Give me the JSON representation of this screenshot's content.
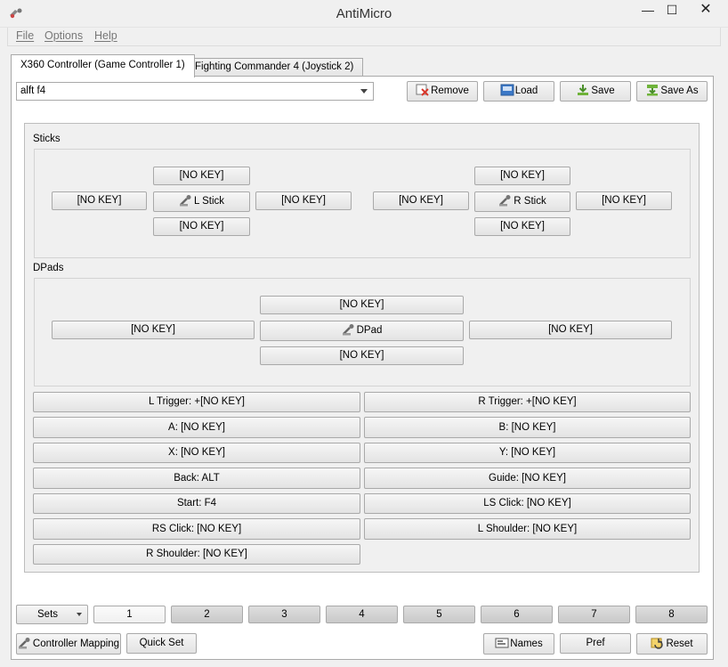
{
  "window": {
    "title": "AntiMicro",
    "icon": "gamepad-icon",
    "controls": {
      "minimize": "—",
      "maximize": "☐",
      "close": "✕"
    }
  },
  "menu": {
    "file": "File",
    "options": "Options",
    "help": "Help"
  },
  "tabs": [
    {
      "label": "X360 Controller (Game Controller 1)",
      "active": true
    },
    {
      "label": "Fighting Commander 4 (Joystick 2)",
      "active": false
    }
  ],
  "profile": {
    "selected": "alft f4",
    "remove_label": "Remove",
    "load_label": "Load",
    "save_label": "Save",
    "save_as_label": "Save As"
  },
  "sticks": {
    "label": "Sticks",
    "left": {
      "up": "[NO KEY]",
      "left": "[NO KEY]",
      "center": "L Stick",
      "right": "[NO KEY]",
      "down": "[NO KEY]"
    },
    "right": {
      "up": "[NO KEY]",
      "left": "[NO KEY]",
      "center": "R Stick",
      "right": "[NO KEY]",
      "down": "[NO KEY]"
    }
  },
  "dpads": {
    "label": "DPads",
    "up": "[NO KEY]",
    "left": "[NO KEY]",
    "center": "DPad",
    "right": "[NO KEY]",
    "down": "[NO KEY]"
  },
  "buttons": {
    "l_trigger": "L Trigger: +[NO KEY]",
    "r_trigger": "R Trigger: +[NO KEY]",
    "a": "A: [NO KEY]",
    "b": "B: [NO KEY]",
    "x": "X: [NO KEY]",
    "y": "Y: [NO KEY]",
    "back": "Back: ALT",
    "guide": "Guide: [NO KEY]",
    "start": "Start: F4",
    "ls_click": "LS Click: [NO KEY]",
    "rs_click": "RS Click: [NO KEY]",
    "l_shoulder": "L Shoulder: [NO KEY]",
    "r_shoulder": "R Shoulder: [NO KEY]"
  },
  "sets": {
    "label": "Sets",
    "items": [
      "1",
      "2",
      "3",
      "4",
      "5",
      "6",
      "7",
      "8"
    ],
    "current": "1"
  },
  "footer": {
    "controller_mapping": "Controller Mapping",
    "quick_set": "Quick Set",
    "names": "Names",
    "pref": "Pref",
    "reset": "Reset"
  },
  "colors": {
    "window_bg": "#f0f0f0",
    "tab_page_bg": "#ffffff",
    "border": "#a9a9a9",
    "remove_icon": "#d9372b",
    "save_icon": "#6fb33a",
    "load_icon": "#3b78c7"
  }
}
